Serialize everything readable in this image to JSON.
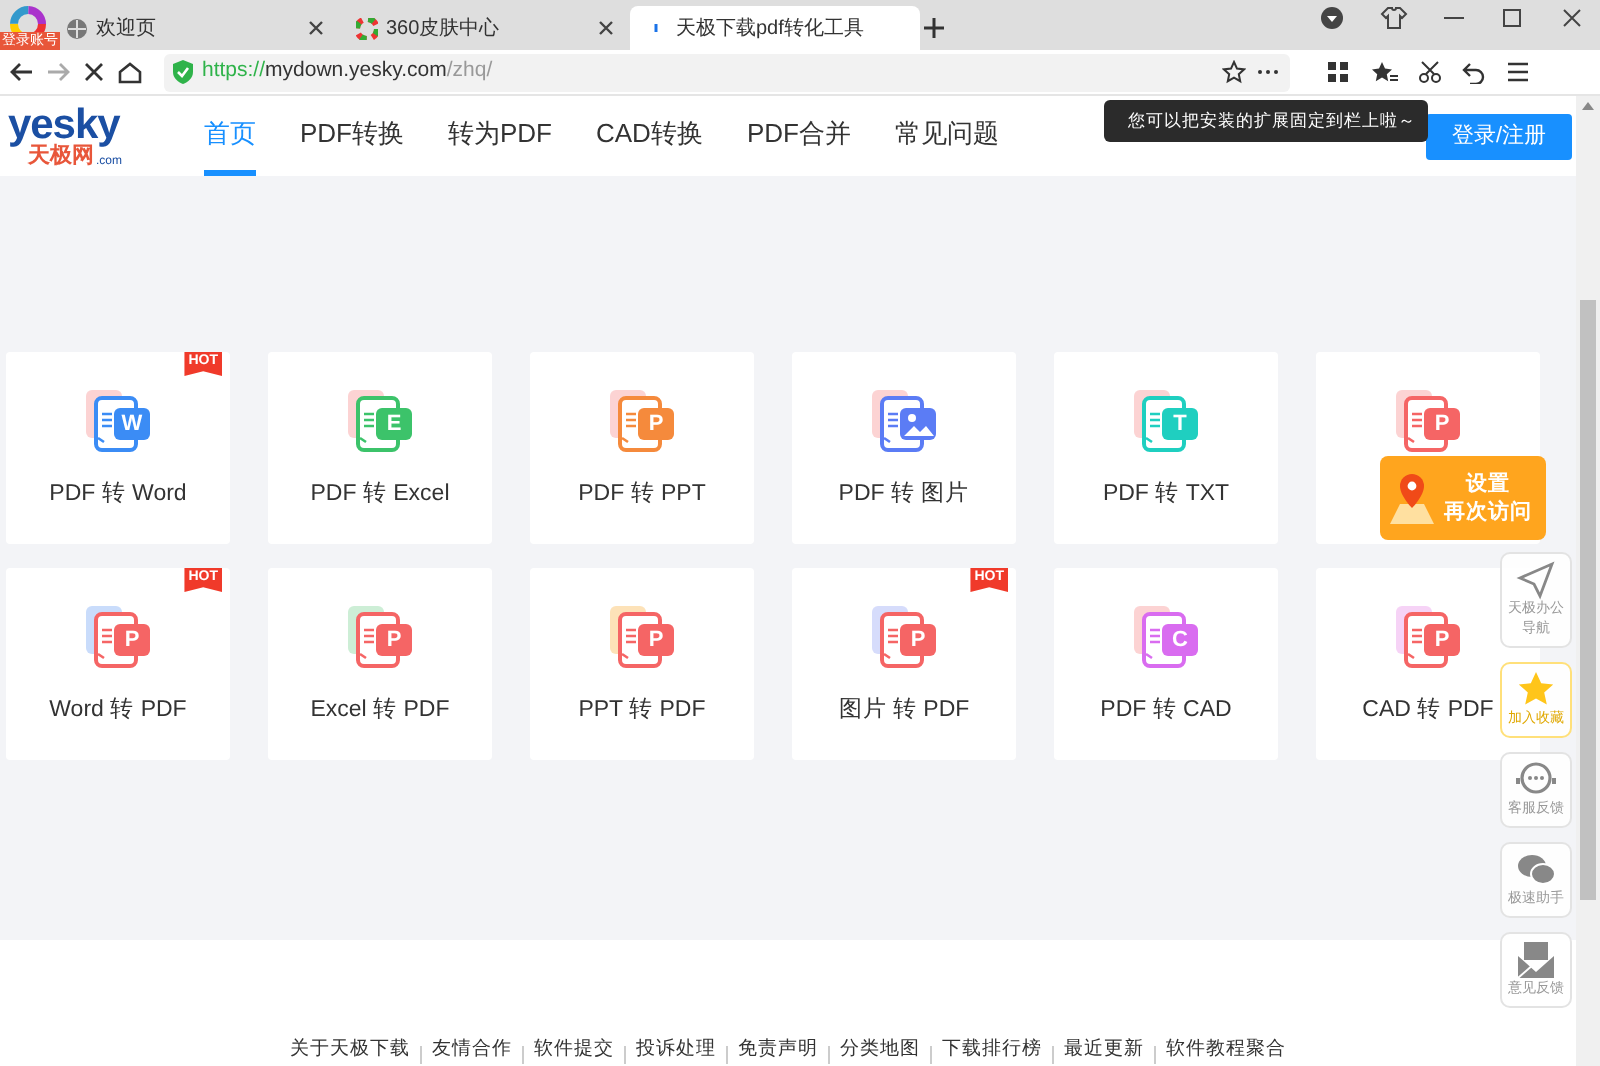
{
  "browser": {
    "account_badge": "登录账号",
    "tabs": [
      {
        "title": "欢迎页",
        "selected": false,
        "kind": "globe"
      },
      {
        "title": "360皮肤中心",
        "selected": false,
        "kind": "color"
      },
      {
        "title": "天极下载pdf转化工具",
        "selected": true,
        "kind": "loading"
      }
    ],
    "url": {
      "scheme": "https://",
      "host": "mydown.yesky.com",
      "path": "/zhq/"
    },
    "tooltip": "您可以把安装的扩展固定到栏上啦～"
  },
  "site": {
    "logo": {
      "word": "yesky",
      "sub": "天极网",
      "dom": ".com"
    },
    "nav": [
      {
        "label": "首页",
        "selected": true
      },
      {
        "label": "PDF转换",
        "selected": false
      },
      {
        "label": "转为PDF",
        "selected": false
      },
      {
        "label": "CAD转换",
        "selected": false
      },
      {
        "label": "PDF合并",
        "selected": false
      },
      {
        "label": "常见问题",
        "selected": false
      }
    ],
    "login": "登录/注册"
  },
  "tools": [
    {
      "label": "PDF 转 Word",
      "kind": "letter",
      "letter": "W",
      "color": "#3b8cf5",
      "back": {
        "color": "#fcd3d3"
      },
      "badge": "HOT"
    },
    {
      "label": "PDF 转 Excel",
      "kind": "letter",
      "letter": "E",
      "color": "#3cc36a",
      "back": {
        "color": "#fcd3d3"
      }
    },
    {
      "label": "PDF 转 PPT",
      "kind": "letter",
      "letter": "P",
      "color": "#f58a3c",
      "back": {
        "color": "#fcd3d3"
      }
    },
    {
      "label": "PDF 转 图片",
      "kind": "image",
      "color": "#5b7cf5",
      "back": {
        "color": "#fcd3d3"
      }
    },
    {
      "label": "PDF 转 TXT",
      "kind": "letter",
      "letter": "T",
      "color": "#1fcfc0",
      "back": {
        "color": "#fcd3d3"
      }
    },
    {
      "kind": "letter",
      "letter": "P",
      "color": "#f56565",
      "back": {
        "color": "#fcd3d3"
      }
    },
    {
      "label": "Word 转 PDF",
      "kind": "letter",
      "letter": "P",
      "color": "#f56565",
      "back": {
        "color": "#c9dcfb"
      },
      "badge": "HOT"
    },
    {
      "label": "Excel 转 PDF",
      "kind": "letter",
      "letter": "P",
      "color": "#f56565",
      "back": {
        "color": "#cdeed6"
      }
    },
    {
      "label": "PPT 转 PDF",
      "kind": "letter",
      "letter": "P",
      "color": "#f56565",
      "back": {
        "color": "#fde2b8"
      }
    },
    {
      "label": "图片 转 PDF",
      "kind": "letter",
      "letter": "P",
      "color": "#f56565",
      "back": {
        "color": "#d6dcfb"
      },
      "badge": "HOT"
    },
    {
      "label": "PDF 转 CAD",
      "kind": "letter",
      "letter": "C",
      "color": "#d96cf0",
      "back": {
        "color": "#fcd3d3"
      }
    },
    {
      "label": "CAD 转 PDF",
      "kind": "letter",
      "letter": "P",
      "color": "#f56565",
      "back": {
        "color": "#f6d3f6"
      }
    }
  ],
  "revisit": {
    "line1": "设置",
    "line2": "再次访问"
  },
  "side": [
    {
      "kind": "send",
      "label": "天极办公导航"
    },
    {
      "kind": "star",
      "label": "加入收藏"
    },
    {
      "kind": "chat",
      "label": "客服反馈"
    },
    {
      "kind": "wechat",
      "label": "极速助手"
    },
    {
      "kind": "mail",
      "label": "意见反馈"
    }
  ],
  "footer": [
    "关于天极下载",
    "友情合作",
    "软件提交",
    "投诉处理",
    "免责声明",
    "分类地图",
    "下载排行榜",
    "最近更新",
    "软件教程聚合"
  ]
}
